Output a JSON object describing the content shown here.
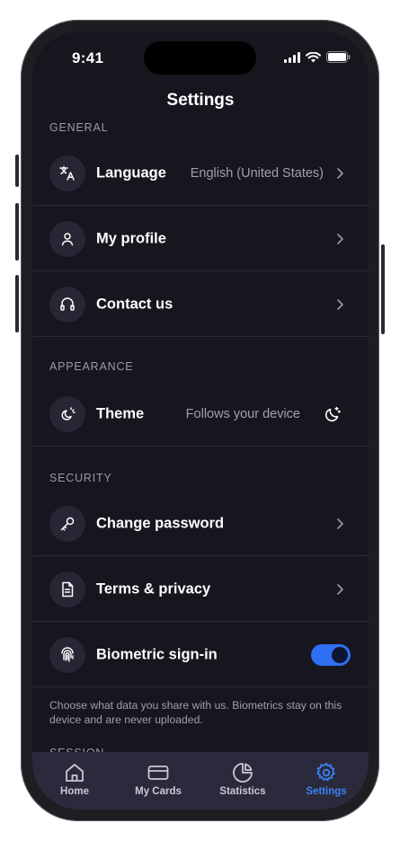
{
  "status_bar": {
    "time": "9:41"
  },
  "header": {
    "title": "Settings"
  },
  "sections": {
    "general": {
      "label": "GENERAL",
      "rows": [
        {
          "label": "Language",
          "value": "English (United States)",
          "icon": "translate-icon"
        },
        {
          "label": "My profile",
          "icon": "person-icon"
        },
        {
          "label": "Contact us",
          "icon": "headset-icon"
        }
      ]
    },
    "appearance": {
      "label": "APPEARANCE",
      "rows": [
        {
          "label": "Theme",
          "value": "Follows your device",
          "icon": "theme-icon",
          "trailing_icon": "moon-icon"
        }
      ]
    },
    "security": {
      "label": "SECURITY",
      "rows": [
        {
          "label": "Change password",
          "icon": "key-icon"
        },
        {
          "label": "Terms & privacy",
          "icon": "document-icon"
        },
        {
          "label": "Biometric sign-in",
          "icon": "fingerprint-icon",
          "toggle_on": true
        }
      ],
      "footnote": "Choose what data you share with us. Biometrics stay on this device and are never uploaded."
    },
    "session": {
      "label": "SESSION"
    }
  },
  "tab_bar": {
    "tabs": [
      {
        "label": "Home",
        "icon": "home-icon",
        "active": false
      },
      {
        "label": "My Cards",
        "icon": "card-icon",
        "active": false
      },
      {
        "label": "Statistics",
        "icon": "pie-chart-icon",
        "active": false
      },
      {
        "label": "Settings",
        "icon": "gear-icon",
        "active": true
      }
    ]
  },
  "colors": {
    "background": "#16161f",
    "accent": "#3b82f6",
    "toggle_on": "#2f6ff3",
    "tab_bar": "#2a2a3c"
  }
}
